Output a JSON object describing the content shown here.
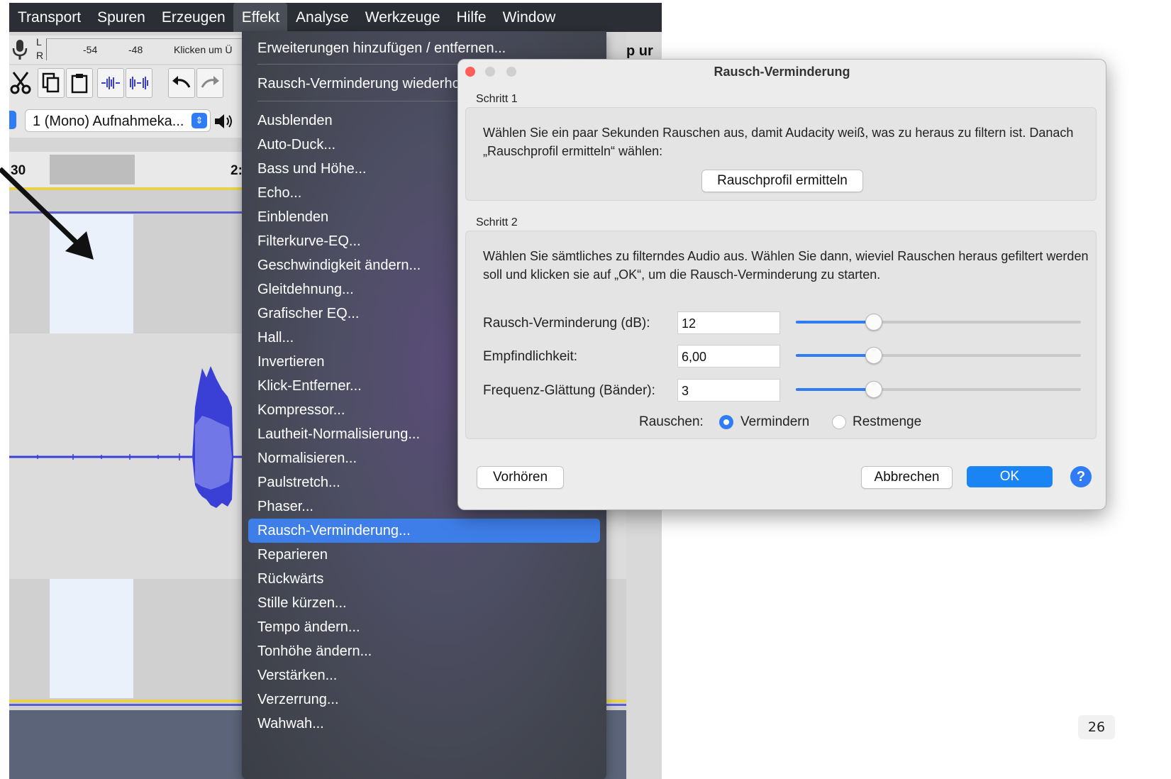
{
  "menubar": {
    "items": [
      "Transport",
      "Spuren",
      "Erzeugen",
      "Effekt",
      "Analyse",
      "Werkzeuge",
      "Hilfe",
      "Window"
    ],
    "active": "Effekt"
  },
  "toolbar": {
    "meter": {
      "l": "L",
      "r": "R",
      "tick1": "-54",
      "tick2": "-48",
      "hint": "Klicken um Ü"
    },
    "device": "1 (Mono) Aufnahmeka...",
    "ruler_start": "30",
    "ruler_mid": "2:"
  },
  "right_strip_text": "p ur",
  "effect_menu": {
    "top_items": [
      "Erweiterungen hinzufügen / entfernen...",
      "Rausch-Verminderung wiederholen"
    ],
    "items": [
      "Ausblenden",
      "Auto-Duck...",
      "Bass und Höhe...",
      "Echo...",
      "Einblenden",
      "Filterkurve-EQ...",
      "Geschwindigkeit ändern...",
      "Gleitdehnung...",
      "Grafischer EQ...",
      "Hall...",
      "Invertieren",
      "Klick-Entferner...",
      "Kompressor...",
      "Lautheit-Normalisierung...",
      "Normalisieren...",
      "Paulstretch...",
      "Phaser...",
      "Rausch-Verminderung...",
      "Reparieren",
      "Rückwärts",
      "Stille kürzen...",
      "Tempo ändern...",
      "Tonhöhe ändern...",
      "Verstärken...",
      "Verzerrung...",
      "Wahwah..."
    ],
    "highlighted": "Rausch-Verminderung..."
  },
  "dialog": {
    "title": "Rausch-Verminderung",
    "step1": {
      "label": "Schritt 1",
      "text": "Wählen Sie ein paar Sekunden Rauschen aus, damit Audacity weiß, was zu heraus zu filtern ist. Danach „Rauschprofil ermitteln“ wählen:",
      "button": "Rauschprofil ermitteln"
    },
    "step2": {
      "label": "Schritt 2",
      "text": "Wählen Sie sämtliches zu filterndes Audio aus. Wählen Sie dann, wieviel Rauschen heraus gefiltert werden soll und klicken sie auf „OK“, um die Rausch-Verminderung zu starten.",
      "fields": [
        {
          "label": "Rausch-Verminderung (dB):",
          "value": "12",
          "slider": 0.27
        },
        {
          "label": "Empfindlichkeit:",
          "value": "6,00",
          "slider": 0.27
        },
        {
          "label": "Frequenz-Glättung (Bänder):",
          "value": "3",
          "slider": 0.27
        }
      ],
      "noise_label": "Rauschen:",
      "options": [
        "Vermindern",
        "Restmenge"
      ],
      "selected": "Vermindern"
    },
    "buttons": {
      "preview": "Vorhören",
      "cancel": "Abbrechen",
      "ok": "OK",
      "help": "?"
    }
  },
  "page_number": "26",
  "colors": {
    "accent": "#2f7cf6",
    "menu_highlight": "#3e7ee8",
    "waveform": "#3a3fd6",
    "close": "#ff5f57"
  }
}
